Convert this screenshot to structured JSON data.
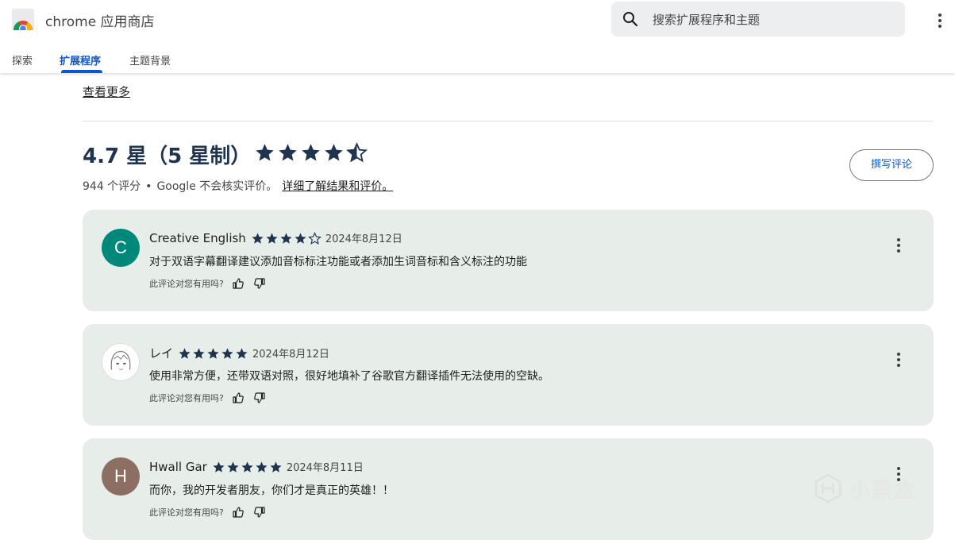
{
  "header": {
    "brand": "chrome 应用商店",
    "search_placeholder": "搜索扩展程序和主题",
    "tabs": [
      {
        "label": "探索"
      },
      {
        "label": "扩展程序"
      },
      {
        "label": "主题背景"
      }
    ],
    "active_tab": "扩展程序"
  },
  "content": {
    "see_more": "查看更多",
    "rating_title": "4.7 星（5 星制）",
    "rating_value": 4.7,
    "rating_count": "944 个评分",
    "separator": "•",
    "disclaimer": "Google 不会核实评价。",
    "learn_more": "详细了解结果和评价。",
    "write_review": "撰写评论"
  },
  "colors": {
    "accent": "#0b57d0",
    "card_bg": "#e7ede8",
    "star": "#1f3450"
  },
  "reviews": [
    {
      "avatar_letter": "C",
      "avatar_color": "#00897b",
      "name": "Creative English",
      "stars": 4,
      "date": "2024年8月12日",
      "text": "对于双语字幕翻译建议添加音标标注功能或者添加生词音标和含义标注的功能",
      "helpful_q": "此评论对您有用吗?"
    },
    {
      "avatar_letter": "",
      "avatar_color": "#ffffff",
      "name": "レイ",
      "stars": 5,
      "date": "2024年8月12日",
      "text": "使用非常方便，还带双语对照，很好地填补了谷歌官方翻译插件无法使用的空缺。",
      "helpful_q": "此评论对您有用吗?"
    },
    {
      "avatar_letter": "H",
      "avatar_color": "#8d6e63",
      "name": "Hwall Gar",
      "stars": 5,
      "date": "2024年8月11日",
      "text": "而你，我的开发者朋友，你们才是真正的英雄！！",
      "helpful_q": "此评论对您有用吗?"
    }
  ],
  "watermark": "小黑盒"
}
